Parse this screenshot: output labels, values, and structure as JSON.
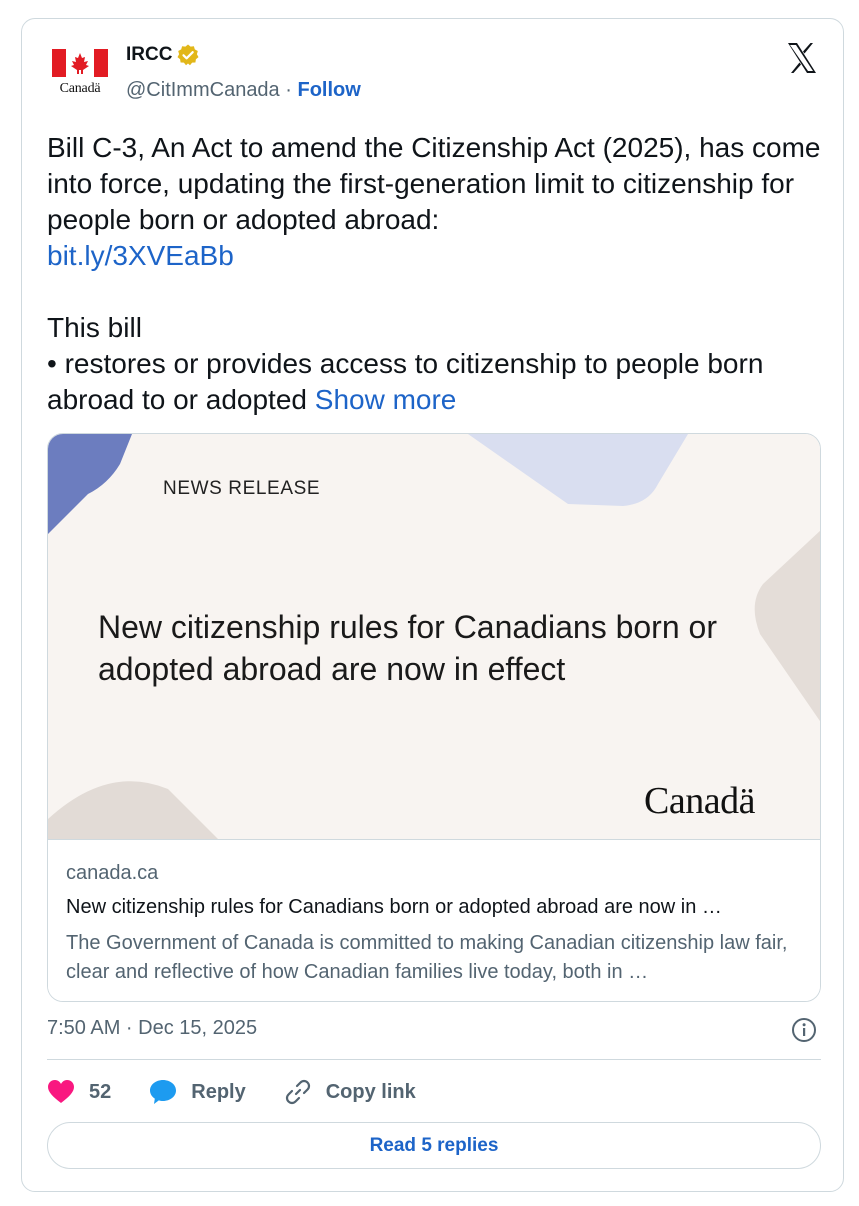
{
  "author": {
    "name": "IRCC",
    "handle": "@CitImmCanada",
    "separator": "·",
    "follow_label": "Follow",
    "avatar_wordmark": "Canadä"
  },
  "tweet": {
    "text_before_link": "Bill C-3, An Act to amend the Citizenship Act (2025), has come into force, updating the first-generation limit to citizenship for people born or adopted abroad:\n",
    "link": "bit.ly/3XVEaBb",
    "text_after_link": "\n\nThis bill\n• restores or provides access to citizenship to people born abroad to or adopted ",
    "show_more": "Show more"
  },
  "card": {
    "image_label": "NEWS RELEASE",
    "image_headline": "New citizenship rules for Canadians born or adopted abroad are now in effect",
    "image_wordmark": "Canadä",
    "domain": "canada.ca",
    "title": "New citizenship rules for Canadians born or adopted abroad are now in …",
    "description": "The Government of Canada is committed to making Canadian citizenship law fair, clear and reflective of how Canadian families live today, both in …"
  },
  "meta": {
    "timestamp": "7:50 AM · Dec 15, 2025"
  },
  "actions": {
    "likes": "52",
    "reply_label": "Reply",
    "copy_link_label": "Copy link"
  },
  "read_replies_label": "Read 5 replies",
  "colors": {
    "link": "#1d64c8",
    "like": "#f91880",
    "reply": "#1d9bf0",
    "muted": "#536471",
    "border": "#cfd9de"
  },
  "icons": [
    "canada-flag-icon",
    "verified-badge-icon",
    "x-logo-icon",
    "info-icon",
    "heart-icon",
    "reply-bubble-icon",
    "link-icon"
  ]
}
